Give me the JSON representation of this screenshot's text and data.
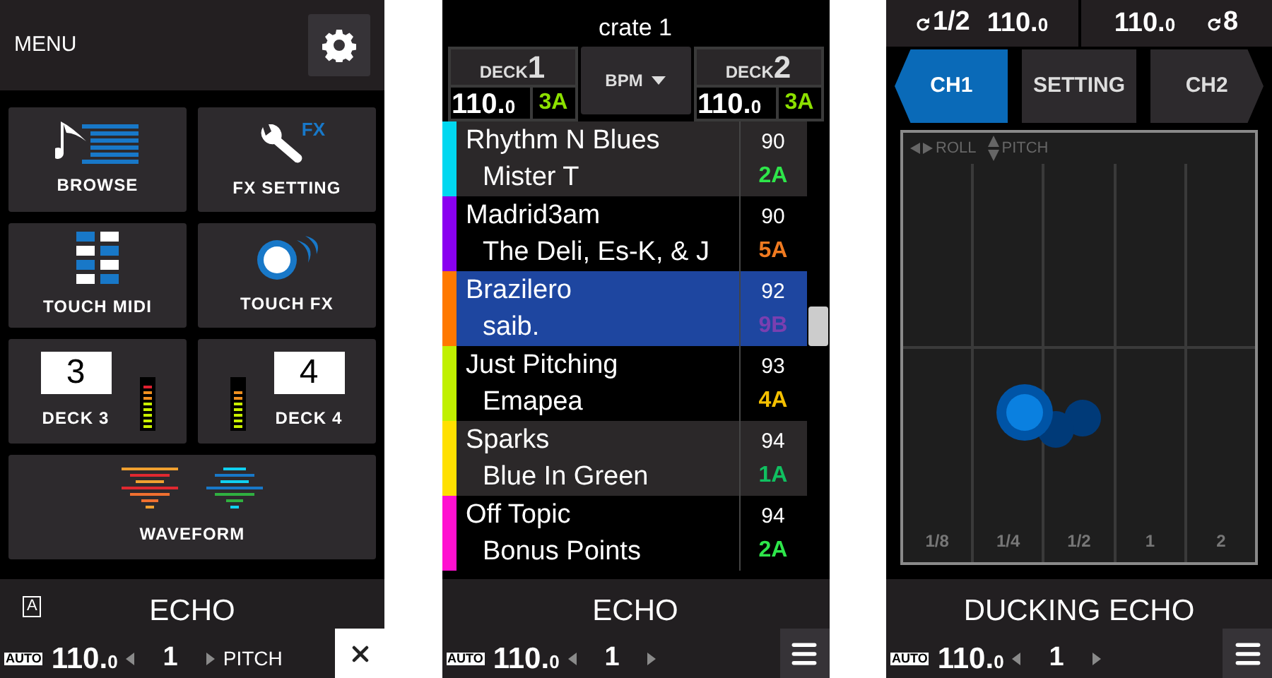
{
  "menu_screen": {
    "title": "MENU",
    "tiles": [
      {
        "kind": "browse",
        "label": "BROWSE"
      },
      {
        "kind": "fx_setting",
        "label": "FX SETTING",
        "icon_text": "FX"
      },
      {
        "kind": "touch_midi",
        "label": "TOUCH MIDI"
      },
      {
        "kind": "touch_fx",
        "label": "TOUCH FX"
      },
      {
        "kind": "deck",
        "label": "DECK 3",
        "number": "3"
      },
      {
        "kind": "deck",
        "label": "DECK 4",
        "number": "4"
      },
      {
        "kind": "waveform",
        "label": "WAVEFORM"
      }
    ],
    "footer": {
      "badge": "A",
      "effect": "ECHO",
      "auto": "AUTO",
      "bpm": "110.",
      "bpm_decimal": "0",
      "beat": "1",
      "param": "PITCH",
      "kind": "close"
    }
  },
  "browse_screen": {
    "title": "crate 1",
    "decks": [
      {
        "label": "DECK",
        "number": "1",
        "bpm": "110.",
        "bpm_decimal": "0",
        "key": {
          "text": "3A",
          "color": "#8ce000"
        }
      },
      {
        "label": "DECK",
        "number": "2",
        "bpm": "110.",
        "bpm_decimal": "0",
        "key": {
          "text": "3A",
          "color": "#8ce000"
        }
      }
    ],
    "sort": "BPM",
    "tracks": [
      {
        "title": "Rhythm N Blues",
        "artist": "Mister T",
        "bpm": "90",
        "key": {
          "text": "2A",
          "color": "#2ee64a"
        },
        "color": "#00d8f0",
        "selected": false
      },
      {
        "title": "Madrid3am",
        "artist": "The Deli, Es-K, & J",
        "bpm": "90",
        "key": {
          "text": "5A",
          "color": "#f07a20"
        },
        "color": "#8a00f0",
        "selected": false
      },
      {
        "title": "Brazilero",
        "artist": "saib.",
        "bpm": "92",
        "key": {
          "text": "9B",
          "color": "#7a3fb0"
        },
        "color": "#ff7800",
        "selected": true
      },
      {
        "title": "Just Pitching",
        "artist": "Emapea",
        "bpm": "93",
        "key": {
          "text": "4A",
          "color": "#f5c000"
        },
        "color": "#c0f000",
        "selected": false
      },
      {
        "title": "Sparks",
        "artist": "Blue In Green",
        "bpm": "94",
        "key": {
          "text": "1A",
          "color": "#10c060"
        },
        "color": "#ffe000",
        "selected": false
      },
      {
        "title": "Off Topic",
        "artist": "Bonus Points",
        "bpm": "94",
        "key": {
          "text": "2A",
          "color": "#2ee64a"
        },
        "color": "#ff10d0",
        "selected": false
      }
    ],
    "footer": {
      "effect": "ECHO",
      "auto": "AUTO",
      "bpm": "110.",
      "bpm_decimal": "0",
      "beat": "1",
      "kind": "menu"
    }
  },
  "touch_fx_screen": {
    "status": [
      {
        "loop": "1/2",
        "bpm": "110.",
        "bpm_decimal": "0"
      },
      {
        "bpm": "110.",
        "bpm_decimal": "0",
        "loop": "8"
      }
    ],
    "tabs": [
      {
        "label": "CH1",
        "selected": true,
        "kind": "previous"
      },
      {
        "label": "SETTING",
        "selected": false,
        "kind": "plain"
      },
      {
        "label": "CH2",
        "selected": false,
        "kind": "next"
      }
    ],
    "pad": {
      "x_legend": "ROLL",
      "y_legend": "PITCH",
      "columns": [
        "1/8",
        "1/4",
        "1/2",
        "1",
        "2"
      ]
    },
    "footer": {
      "effect": "DUCKING ECHO",
      "auto": "AUTO",
      "bpm": "110.",
      "bpm_decimal": "0",
      "beat": "1",
      "kind": "menu"
    }
  }
}
